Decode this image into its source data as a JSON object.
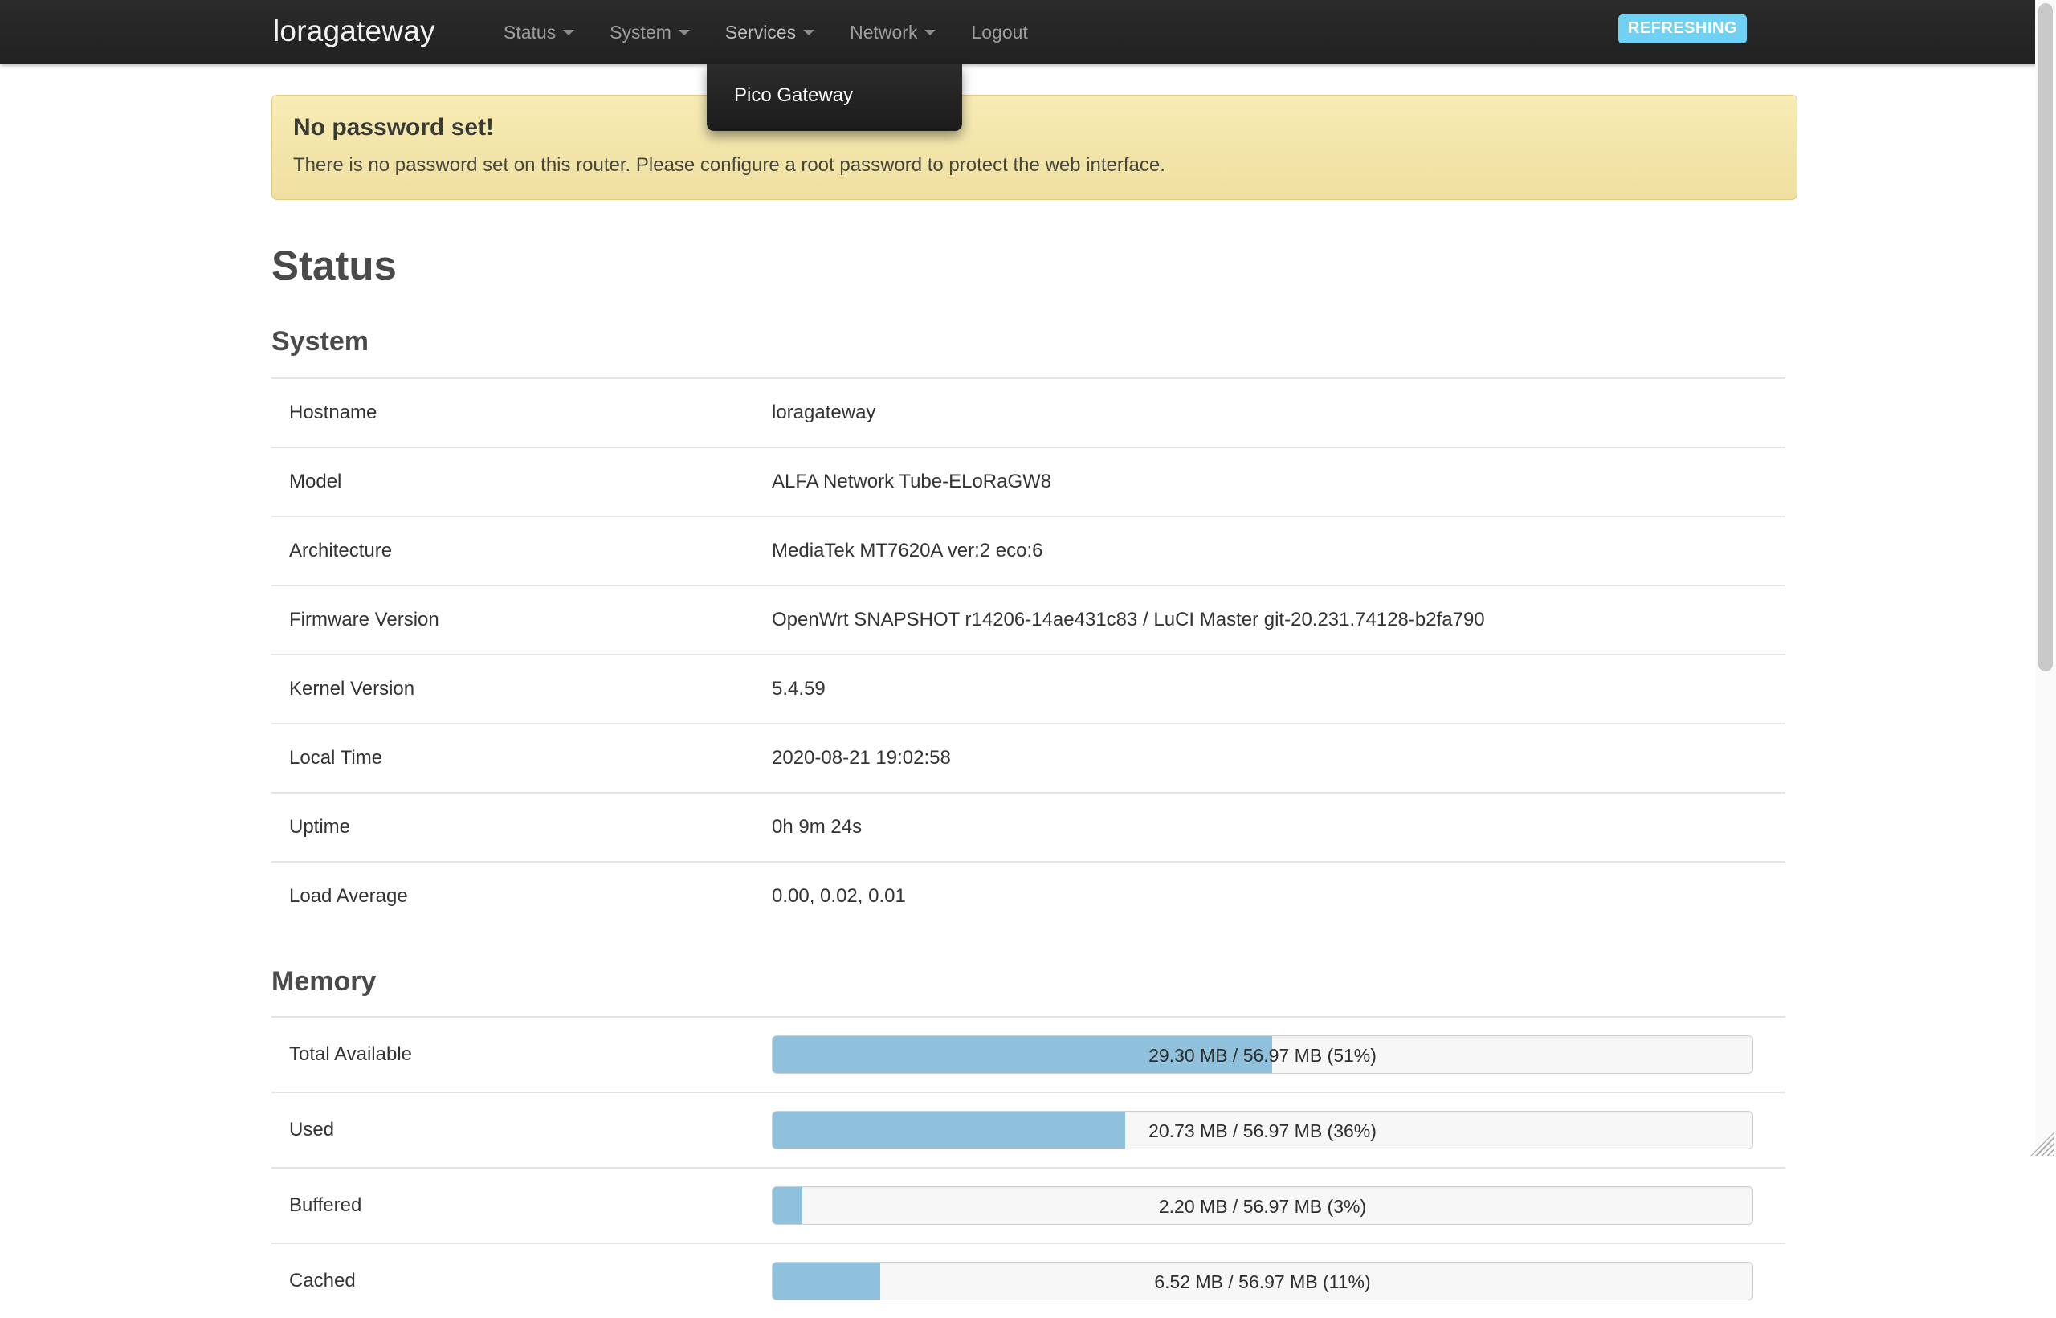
{
  "navbar": {
    "brand": "loragateway",
    "items": [
      {
        "label": "Status",
        "has_caret": true,
        "icon": "chevron-down-icon"
      },
      {
        "label": "System",
        "has_caret": true,
        "icon": "chevron-down-icon"
      },
      {
        "label": "Services",
        "has_caret": true,
        "icon": "chevron-down-icon"
      },
      {
        "label": "Network",
        "has_caret": true,
        "icon": "chevron-down-icon"
      },
      {
        "label": "Logout",
        "has_caret": false,
        "icon": ""
      }
    ],
    "refresh_badge": "REFRESHING",
    "refresh_badge_color": "#6fd2f5",
    "background_color": "#262626"
  },
  "dropdown": {
    "parent": "Services",
    "items": [
      {
        "label": "Pico Gateway"
      }
    ]
  },
  "alert": {
    "title": "No password set!",
    "text": "There is no password set on this router. Please configure a root password to protect the web interface.",
    "background_color": "#f2e3a8"
  },
  "page": {
    "title": "Status"
  },
  "system": {
    "heading": "System",
    "rows": [
      {
        "label": "Hostname",
        "value": "loragateway"
      },
      {
        "label": "Model",
        "value": "ALFA Network Tube-ELoRaGW8"
      },
      {
        "label": "Architecture",
        "value": "MediaTek MT7620A ver:2 eco:6"
      },
      {
        "label": "Firmware Version",
        "value": "OpenWrt SNAPSHOT r14206-14ae431c83 / LuCI Master git-20.231.74128-b2fa790"
      },
      {
        "label": "Kernel Version",
        "value": "5.4.59"
      },
      {
        "label": "Local Time",
        "value": "2020-08-21 19:02:58"
      },
      {
        "label": "Uptime",
        "value": "0h 9m 24s"
      },
      {
        "label": "Load Average",
        "value": "0.00, 0.02, 0.01"
      }
    ]
  },
  "memory": {
    "heading": "Memory",
    "bar_color": "#8fc0dc",
    "rows": [
      {
        "label": "Total Available",
        "text": "29.30 MB / 56.97 MB (51%)",
        "percent": 51
      },
      {
        "label": "Used",
        "text": "20.73 MB / 56.97 MB (36%)",
        "percent": 36
      },
      {
        "label": "Buffered",
        "text": "2.20 MB / 56.97 MB (3%)",
        "percent": 3
      },
      {
        "label": "Cached",
        "text": "6.52 MB / 56.97 MB (11%)",
        "percent": 11
      }
    ]
  }
}
